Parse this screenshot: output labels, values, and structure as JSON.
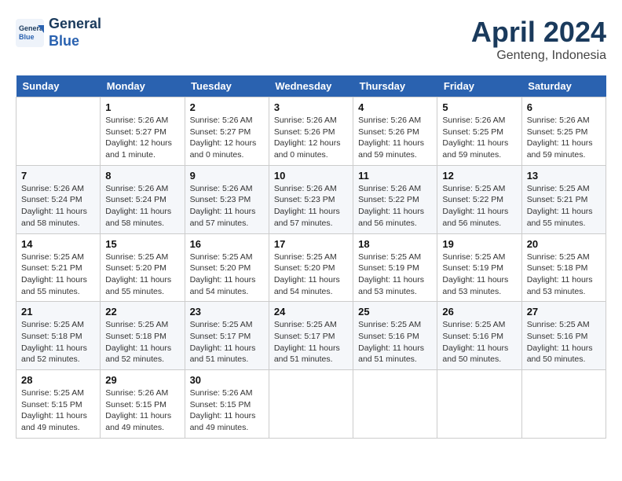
{
  "header": {
    "logo_line1": "General",
    "logo_line2": "Blue",
    "month": "April 2024",
    "location": "Genteng, Indonesia"
  },
  "columns": [
    "Sunday",
    "Monday",
    "Tuesday",
    "Wednesday",
    "Thursday",
    "Friday",
    "Saturday"
  ],
  "weeks": [
    [
      {
        "day": "",
        "info": ""
      },
      {
        "day": "1",
        "info": "Sunrise: 5:26 AM\nSunset: 5:27 PM\nDaylight: 12 hours\nand 1 minute."
      },
      {
        "day": "2",
        "info": "Sunrise: 5:26 AM\nSunset: 5:27 PM\nDaylight: 12 hours\nand 0 minutes."
      },
      {
        "day": "3",
        "info": "Sunrise: 5:26 AM\nSunset: 5:26 PM\nDaylight: 12 hours\nand 0 minutes."
      },
      {
        "day": "4",
        "info": "Sunrise: 5:26 AM\nSunset: 5:26 PM\nDaylight: 11 hours\nand 59 minutes."
      },
      {
        "day": "5",
        "info": "Sunrise: 5:26 AM\nSunset: 5:25 PM\nDaylight: 11 hours\nand 59 minutes."
      },
      {
        "day": "6",
        "info": "Sunrise: 5:26 AM\nSunset: 5:25 PM\nDaylight: 11 hours\nand 59 minutes."
      }
    ],
    [
      {
        "day": "7",
        "info": "Sunrise: 5:26 AM\nSunset: 5:24 PM\nDaylight: 11 hours\nand 58 minutes."
      },
      {
        "day": "8",
        "info": "Sunrise: 5:26 AM\nSunset: 5:24 PM\nDaylight: 11 hours\nand 58 minutes."
      },
      {
        "day": "9",
        "info": "Sunrise: 5:26 AM\nSunset: 5:23 PM\nDaylight: 11 hours\nand 57 minutes."
      },
      {
        "day": "10",
        "info": "Sunrise: 5:26 AM\nSunset: 5:23 PM\nDaylight: 11 hours\nand 57 minutes."
      },
      {
        "day": "11",
        "info": "Sunrise: 5:26 AM\nSunset: 5:22 PM\nDaylight: 11 hours\nand 56 minutes."
      },
      {
        "day": "12",
        "info": "Sunrise: 5:25 AM\nSunset: 5:22 PM\nDaylight: 11 hours\nand 56 minutes."
      },
      {
        "day": "13",
        "info": "Sunrise: 5:25 AM\nSunset: 5:21 PM\nDaylight: 11 hours\nand 55 minutes."
      }
    ],
    [
      {
        "day": "14",
        "info": "Sunrise: 5:25 AM\nSunset: 5:21 PM\nDaylight: 11 hours\nand 55 minutes."
      },
      {
        "day": "15",
        "info": "Sunrise: 5:25 AM\nSunset: 5:20 PM\nDaylight: 11 hours\nand 55 minutes."
      },
      {
        "day": "16",
        "info": "Sunrise: 5:25 AM\nSunset: 5:20 PM\nDaylight: 11 hours\nand 54 minutes."
      },
      {
        "day": "17",
        "info": "Sunrise: 5:25 AM\nSunset: 5:20 PM\nDaylight: 11 hours\nand 54 minutes."
      },
      {
        "day": "18",
        "info": "Sunrise: 5:25 AM\nSunset: 5:19 PM\nDaylight: 11 hours\nand 53 minutes."
      },
      {
        "day": "19",
        "info": "Sunrise: 5:25 AM\nSunset: 5:19 PM\nDaylight: 11 hours\nand 53 minutes."
      },
      {
        "day": "20",
        "info": "Sunrise: 5:25 AM\nSunset: 5:18 PM\nDaylight: 11 hours\nand 53 minutes."
      }
    ],
    [
      {
        "day": "21",
        "info": "Sunrise: 5:25 AM\nSunset: 5:18 PM\nDaylight: 11 hours\nand 52 minutes."
      },
      {
        "day": "22",
        "info": "Sunrise: 5:25 AM\nSunset: 5:18 PM\nDaylight: 11 hours\nand 52 minutes."
      },
      {
        "day": "23",
        "info": "Sunrise: 5:25 AM\nSunset: 5:17 PM\nDaylight: 11 hours\nand 51 minutes."
      },
      {
        "day": "24",
        "info": "Sunrise: 5:25 AM\nSunset: 5:17 PM\nDaylight: 11 hours\nand 51 minutes."
      },
      {
        "day": "25",
        "info": "Sunrise: 5:25 AM\nSunset: 5:16 PM\nDaylight: 11 hours\nand 51 minutes."
      },
      {
        "day": "26",
        "info": "Sunrise: 5:25 AM\nSunset: 5:16 PM\nDaylight: 11 hours\nand 50 minutes."
      },
      {
        "day": "27",
        "info": "Sunrise: 5:25 AM\nSunset: 5:16 PM\nDaylight: 11 hours\nand 50 minutes."
      }
    ],
    [
      {
        "day": "28",
        "info": "Sunrise: 5:25 AM\nSunset: 5:15 PM\nDaylight: 11 hours\nand 49 minutes."
      },
      {
        "day": "29",
        "info": "Sunrise: 5:26 AM\nSunset: 5:15 PM\nDaylight: 11 hours\nand 49 minutes."
      },
      {
        "day": "30",
        "info": "Sunrise: 5:26 AM\nSunset: 5:15 PM\nDaylight: 11 hours\nand 49 minutes."
      },
      {
        "day": "",
        "info": ""
      },
      {
        "day": "",
        "info": ""
      },
      {
        "day": "",
        "info": ""
      },
      {
        "day": "",
        "info": ""
      }
    ]
  ]
}
